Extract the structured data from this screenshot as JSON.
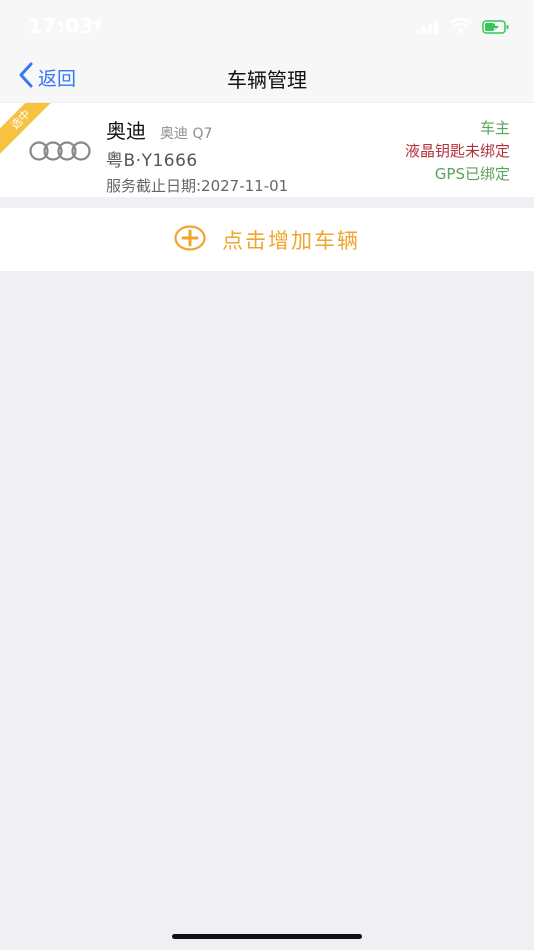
{
  "status_bar": {
    "time": "17:03"
  },
  "nav": {
    "back_label": "返回",
    "title": "车辆管理"
  },
  "vehicle": {
    "ribbon": "选中",
    "brand": "奥迪",
    "model": "奥迪 Q7",
    "plate": "粤B·Y1666",
    "service_date": "服务截止日期:2027-11-01",
    "role": "车主",
    "lcd_key_status": "液晶钥匙未绑定",
    "gps_status": "GPS已绑定"
  },
  "add_vehicle": {
    "label": "点击增加车辆"
  },
  "colors": {
    "accent_blue": "#3478f6",
    "accent_orange": "#f0a52f",
    "green": "#5aa35a",
    "red": "#b3323c",
    "ribbon": "#f5c242"
  }
}
